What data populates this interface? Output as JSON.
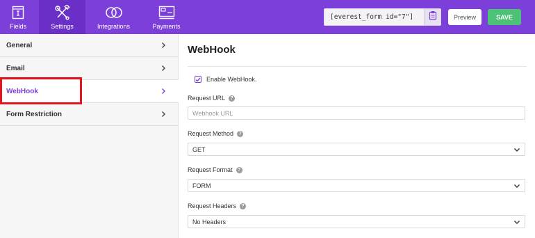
{
  "topbar": {
    "tabs": [
      {
        "label": "Fields",
        "icon": "fields-icon"
      },
      {
        "label": "Settings",
        "icon": "settings-tools-icon"
      },
      {
        "label": "Integrations",
        "icon": "integrations-rings-icon"
      },
      {
        "label": "Payments",
        "icon": "payments-card-icon"
      }
    ],
    "shortcode": "[everest_form id=\"7\"]",
    "preview_label": "Preview",
    "save_label": "SAVE"
  },
  "sidebar": {
    "items": [
      {
        "label": "General"
      },
      {
        "label": "Email"
      },
      {
        "label": "WebHook"
      },
      {
        "label": "Form Restriction"
      }
    ]
  },
  "main": {
    "title": "WebHook",
    "enable_label": "Enable WebHook.",
    "request_url": {
      "label": "Request URL",
      "placeholder": "Webhook URL"
    },
    "request_method": {
      "label": "Request Method",
      "value": "GET"
    },
    "request_format": {
      "label": "Request Format",
      "value": "FORM"
    },
    "request_headers": {
      "label": "Request Headers",
      "value": "No Headers"
    }
  },
  "colors": {
    "brand": "#7c3fd9",
    "save": "#4cc277",
    "highlight": "#e3141e"
  }
}
